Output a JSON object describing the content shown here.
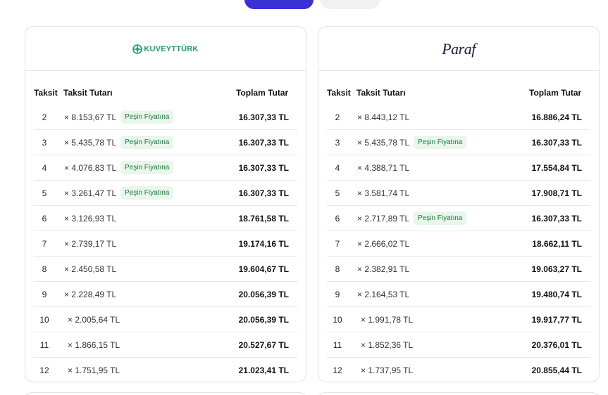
{
  "tabs": {
    "active_label": "",
    "inactive_label": ""
  },
  "headers": {
    "taksit": "Taksit",
    "tutar": "Taksit Tutarı",
    "toplam": "Toplam Tutar"
  },
  "badge_label": "Peşin Fiyatına",
  "cards": [
    {
      "bank": "KuveytTürk",
      "logo_text": "KUVEYTTÜRK",
      "brand_color": "#1f9a6a",
      "rows": [
        {
          "n": "2",
          "amount": "× 8.153,67 TL",
          "badge": true,
          "total": "16.307,33 TL"
        },
        {
          "n": "3",
          "amount": "× 5.435,78 TL",
          "badge": true,
          "total": "16.307,33 TL"
        },
        {
          "n": "4",
          "amount": "× 4.076,83 TL",
          "badge": true,
          "total": "16.307,33 TL"
        },
        {
          "n": "5",
          "amount": "× 3.261,47 TL",
          "badge": true,
          "total": "16.307,33 TL"
        },
        {
          "n": "6",
          "amount": "× 3.126,93 TL",
          "badge": false,
          "total": "18.761,58 TL"
        },
        {
          "n": "7",
          "amount": "× 2.739,17 TL",
          "badge": false,
          "total": "19.174,16 TL"
        },
        {
          "n": "8",
          "amount": "× 2.450,58 TL",
          "badge": false,
          "total": "19.604,67 TL"
        },
        {
          "n": "9",
          "amount": "× 2.228,49 TL",
          "badge": false,
          "total": "20.056,39 TL"
        },
        {
          "n": "10",
          "amount": "× 2.005,64 TL",
          "badge": false,
          "total": "20.056,39 TL"
        },
        {
          "n": "11",
          "amount": "× 1.866,15 TL",
          "badge": false,
          "total": "20.527,67 TL"
        },
        {
          "n": "12",
          "amount": "× 1.751,95 TL",
          "badge": false,
          "total": "21.023,41 TL"
        }
      ]
    },
    {
      "bank": "Paraf",
      "logo_text": "Paraf",
      "brand_color": "#15214a",
      "rows": [
        {
          "n": "2",
          "amount": "× 8.443,12 TL",
          "badge": false,
          "total": "16.886,24 TL"
        },
        {
          "n": "3",
          "amount": "× 5.435,78 TL",
          "badge": true,
          "total": "16.307,33 TL"
        },
        {
          "n": "4",
          "amount": "× 4.388,71 TL",
          "badge": false,
          "total": "17.554,84 TL"
        },
        {
          "n": "5",
          "amount": "× 3.581,74 TL",
          "badge": false,
          "total": "17.908,71 TL"
        },
        {
          "n": "6",
          "amount": "× 2.717,89 TL",
          "badge": true,
          "total": "16.307,33 TL"
        },
        {
          "n": "7",
          "amount": "× 2.666,02 TL",
          "badge": false,
          "total": "18.662,11 TL"
        },
        {
          "n": "8",
          "amount": "× 2.382,91 TL",
          "badge": false,
          "total": "19.063,27 TL"
        },
        {
          "n": "9",
          "amount": "× 2.164,53 TL",
          "badge": false,
          "total": "19.480,74 TL"
        },
        {
          "n": "10",
          "amount": "× 1.991,78 TL",
          "badge": false,
          "total": "19.917,77 TL"
        },
        {
          "n": "11",
          "amount": "× 1.852,36 TL",
          "badge": false,
          "total": "20.376,01 TL"
        },
        {
          "n": "12",
          "amount": "× 1.737,95 TL",
          "badge": false,
          "total": "20.855,44 TL"
        }
      ]
    }
  ]
}
